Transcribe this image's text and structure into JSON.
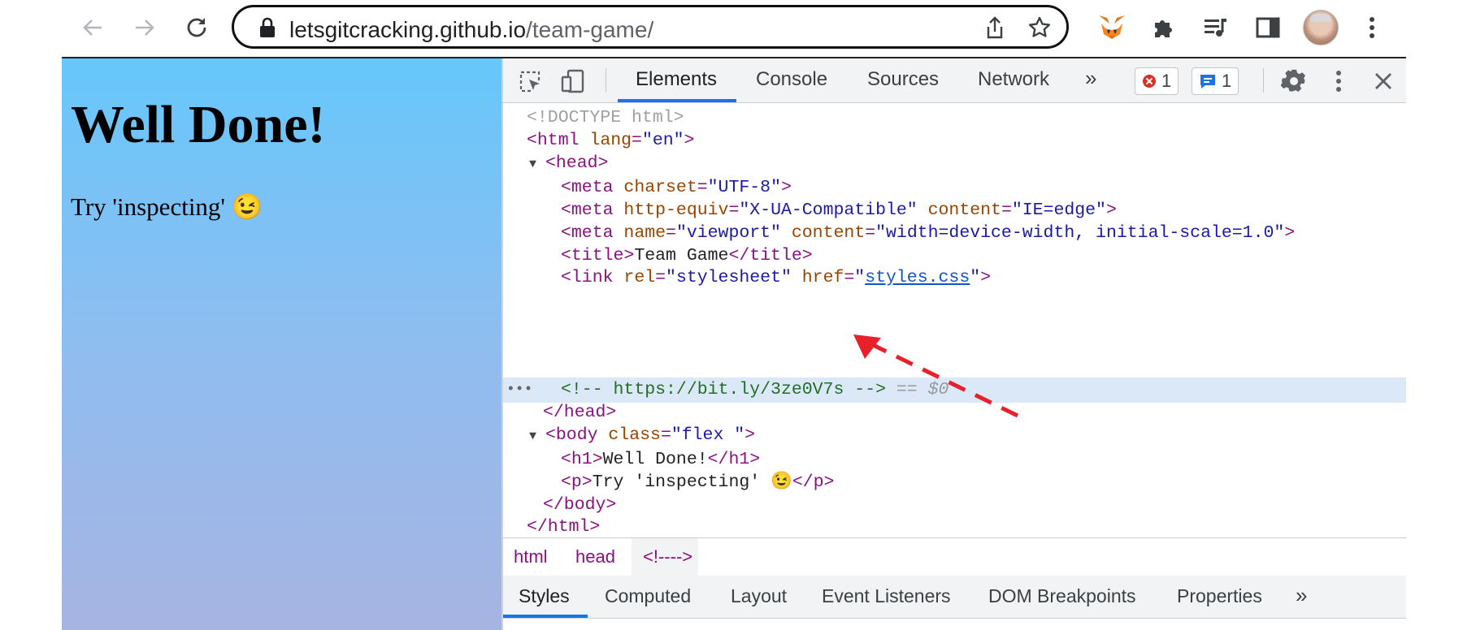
{
  "browser": {
    "url_host": "letsgitcracking.github.io",
    "url_path": "/team-game/",
    "icons": [
      "back-icon",
      "forward-icon",
      "reload-icon",
      "lock-icon",
      "share-icon",
      "star-icon",
      "metamask-fox-icon",
      "puzzle-extensions-icon",
      "media-queue-icon",
      "side-panel-icon",
      "profile-avatar",
      "kebab-menu-icon"
    ]
  },
  "page": {
    "heading": "Well Done!",
    "paragraph": "Try 'inspecting' 😉",
    "gradient_colors": [
      "#66c7fb",
      "#a7b4e2"
    ]
  },
  "devtools": {
    "tabs": [
      "Elements",
      "Console",
      "Sources",
      "Network"
    ],
    "more_tabs": "»",
    "errors_count": "1",
    "messages_count": "1",
    "dom": {
      "doctype": "<!DOCTYPE html>",
      "html_open": "<html",
      "html_lang_attr": "lang",
      "html_lang_val": "\"en\"",
      "head_open": "<head>",
      "meta1_attr": "charset",
      "meta1_val": "\"UTF-8\"",
      "meta2_attr1": "http-equiv",
      "meta2_val1": "\"X-UA-Compatible\"",
      "meta2_attr2": "content",
      "meta2_val2": "\"IE=edge\"",
      "meta3_attr1": "name",
      "meta3_val1": "\"viewport\"",
      "meta3_attr2": "content",
      "meta3_val2": "\"width=device-width, initial-scale=1.0\"",
      "title_text": "Team Game",
      "link_attr1": "rel",
      "link_val1": "\"stylesheet\"",
      "link_attr2": "href",
      "link_href": "styles.css",
      "comment": "<!-- https://bit.ly/3ze0V7s -->",
      "selected_marker": "== $0",
      "head_close": "</head>",
      "body_attr": "class",
      "body_val": "\"flex \"",
      "h1_text": "Well Done!",
      "p_text": "Try 'inspecting' 😉",
      "body_close": "</body>",
      "html_close": "</html>"
    },
    "breadcrumb": [
      "html",
      "head",
      "<!---->"
    ],
    "sub_tabs": [
      "Styles",
      "Computed",
      "Layout",
      "Event Listeners",
      "DOM Breakpoints",
      "Properties"
    ],
    "sub_more": "»"
  },
  "annotation": {
    "arrow_color": "#e8202a"
  }
}
